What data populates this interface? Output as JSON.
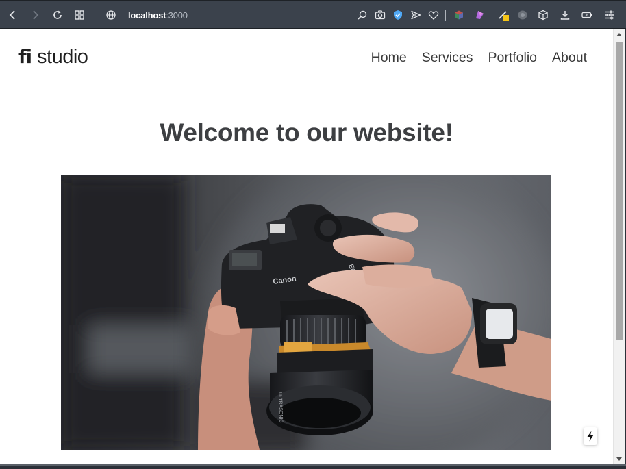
{
  "browser": {
    "url_host": "localhost",
    "url_port": ":3000"
  },
  "site": {
    "logo_mark": "fi",
    "logo_word": "studio",
    "nav": [
      {
        "label": "Home"
      },
      {
        "label": "Services"
      },
      {
        "label": "Portfolio"
      },
      {
        "label": "About"
      }
    ],
    "hero_title": "Welcome to our website!",
    "camera_brand": "Canon",
    "camera_model": "EOS 5D"
  },
  "colors": {
    "chrome": "#3b424c",
    "page_bg": "#ffffff",
    "heading": "#3d3f42",
    "nav_text": "#3a3a3a"
  },
  "icons": {
    "toolbar": [
      "back-icon",
      "forward-icon",
      "reload-icon",
      "tabs-grid-icon",
      "globe-icon",
      "zoom-icon",
      "camera-icon",
      "shield-icon",
      "send-icon",
      "heart-icon",
      "cube-extension-icon",
      "paint-extension-icon",
      "pen-extension-icon",
      "circle-extension-icon",
      "box-icon",
      "download-icon",
      "battery-icon",
      "menu-icon"
    ],
    "page": [
      "bolt-icon"
    ]
  }
}
